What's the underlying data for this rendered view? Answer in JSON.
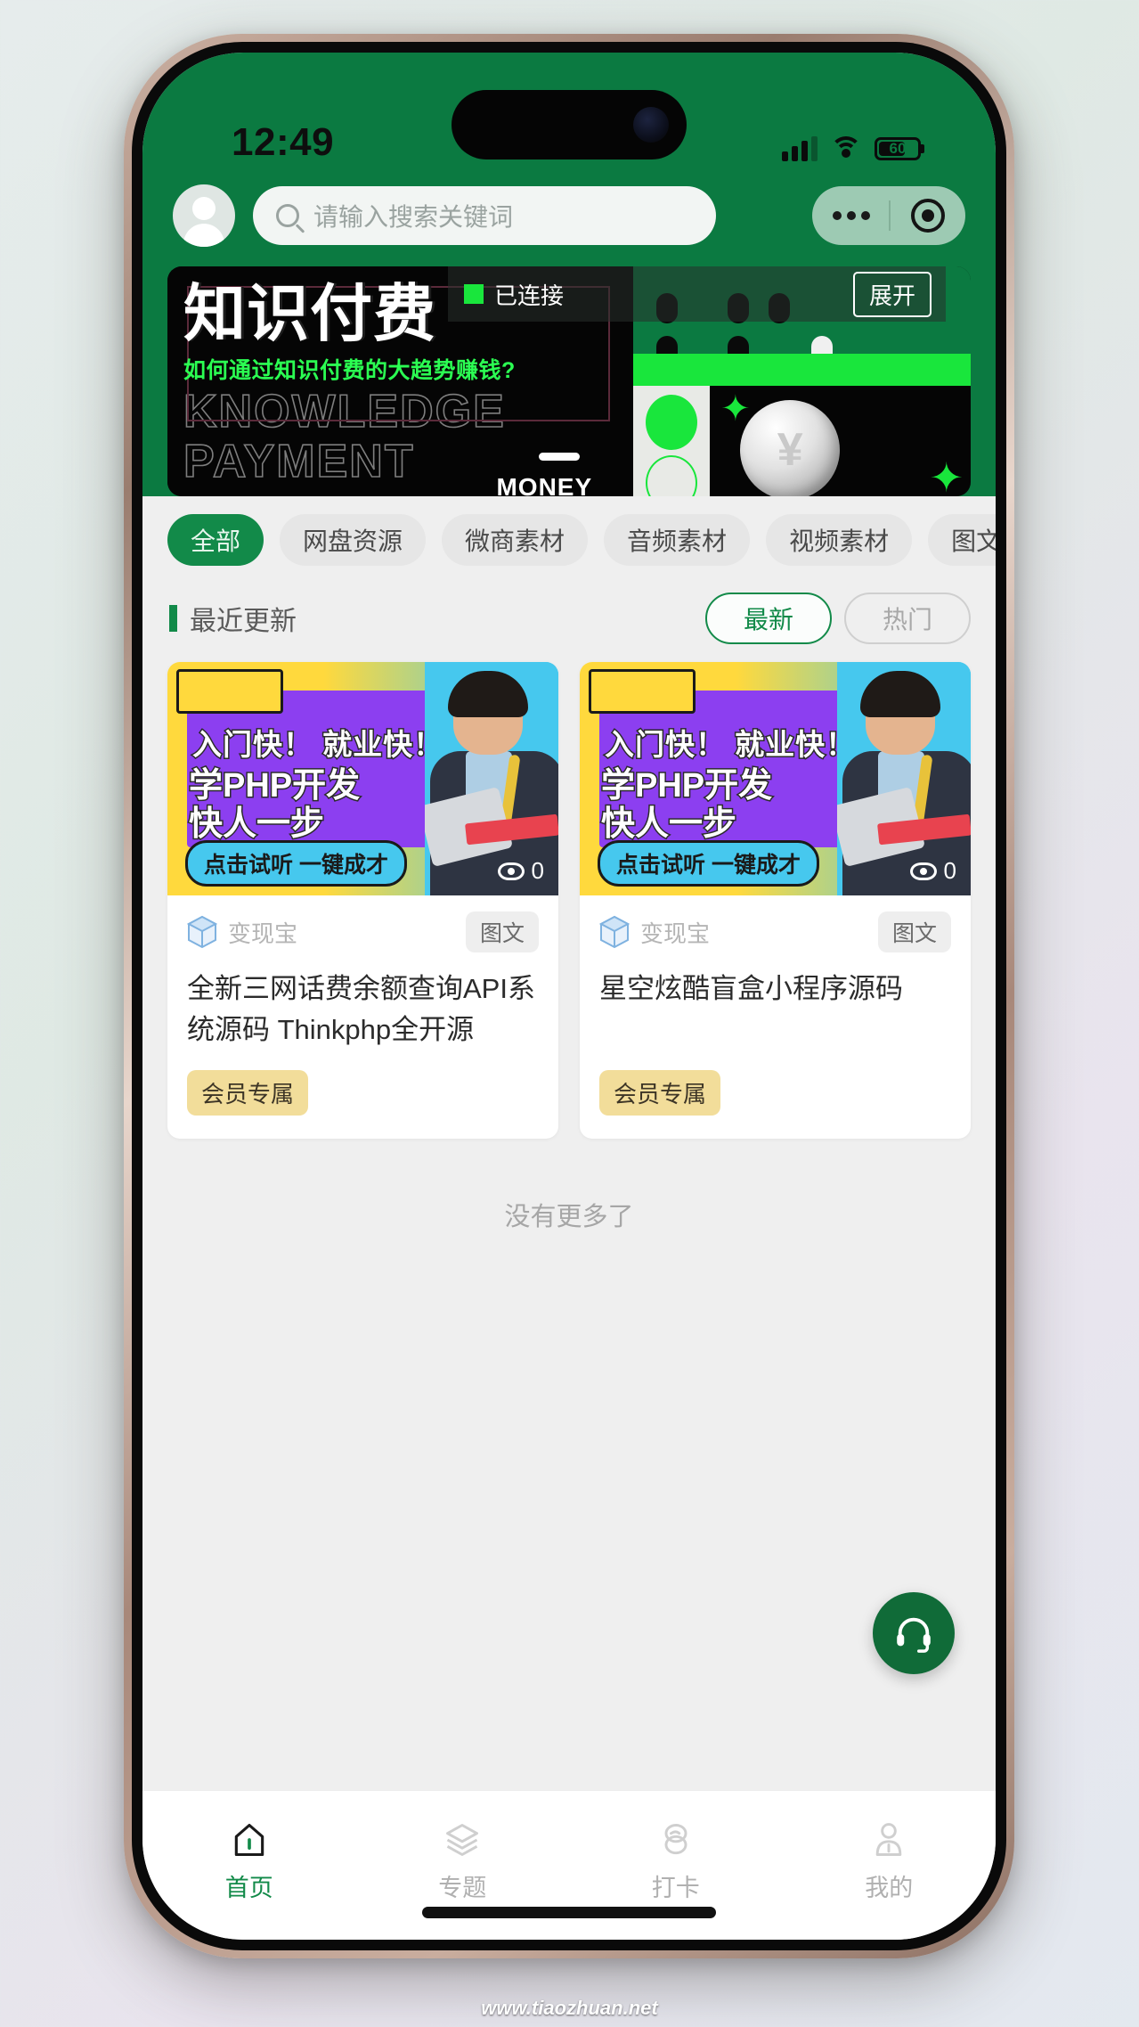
{
  "status_bar": {
    "time": "12:49",
    "battery_level": "60",
    "signal_icon": "signal-bars-icon",
    "wifi_icon": "wifi-icon",
    "battery_icon": "battery-icon"
  },
  "header": {
    "avatar_icon": "user-avatar-icon",
    "search_placeholder": "请输入搜索关键词",
    "search_value": "",
    "search_icon": "search-icon",
    "capsule_more_icon": "more-dots-icon",
    "capsule_target_icon": "target-circle-icon"
  },
  "banner": {
    "title": "知识付费",
    "subtitle": "如何通过知识付费的大趋势赚钱?",
    "outline_line1": "KNOWLEDGE",
    "outline_line2": "PAYMENT",
    "money_label": "MONEY",
    "coin_symbol": "¥",
    "overlay": {
      "status_text": "已连接",
      "expand_button": "展开"
    }
  },
  "categories": [
    {
      "label": "全部",
      "active": true
    },
    {
      "label": "网盘资源",
      "active": false
    },
    {
      "label": "微商素材",
      "active": false
    },
    {
      "label": "音频素材",
      "active": false
    },
    {
      "label": "视频素材",
      "active": false
    },
    {
      "label": "图文素材",
      "active": false
    }
  ],
  "section": {
    "title": "最近更新",
    "sort_latest": "最新",
    "sort_hot": "热门"
  },
  "cards": [
    {
      "thumb_line1": "入门快！ 就业快！",
      "thumb_line2a": "学PHP开发",
      "thumb_line2b": "快人一步",
      "thumb_badge": "点击试听 一键成才",
      "views": "0",
      "source": "变现宝",
      "type_tag": "图文",
      "title": "全新三网话费余额查询API系统源码 Thinkphp全开源",
      "vip_badge": "会员专属"
    },
    {
      "thumb_line1": "入门快！ 就业快！",
      "thumb_line2a": "学PHP开发",
      "thumb_line2b": "快人一步",
      "thumb_badge": "点击试听 一键成才",
      "views": "0",
      "source": "变现宝",
      "type_tag": "图文",
      "title": "星空炫酷盲盒小程序源码",
      "vip_badge": "会员专属"
    }
  ],
  "list_end_text": "没有更多了",
  "support_fab": {
    "icon": "headset-icon"
  },
  "tabbar": [
    {
      "label": "首页",
      "icon": "home-icon",
      "active": true
    },
    {
      "label": "专题",
      "icon": "layers-icon",
      "active": false
    },
    {
      "label": "打卡",
      "icon": "stamp-icon",
      "active": false
    },
    {
      "label": "我的",
      "icon": "person-icon",
      "active": false
    }
  ],
  "watermark": "www.tiaozhuan.net",
  "colors": {
    "brand_green": "#0b7a41",
    "accent_green": "#128a49",
    "neon_green": "#19e63c",
    "vip_gold": "#f2dd9a"
  }
}
